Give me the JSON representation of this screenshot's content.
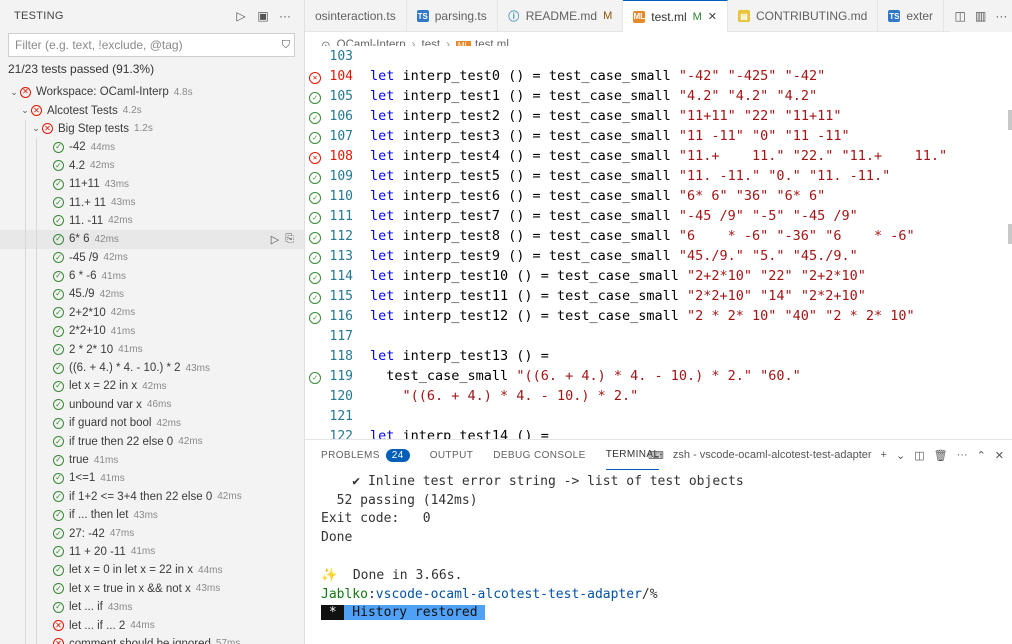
{
  "testing": {
    "title": "TESTING",
    "filter_placeholder": "Filter (e.g. text, !exclude, @tag)",
    "summary": "21/23 tests passed (91.3%)",
    "tree": [
      {
        "label": "Workspace: OCaml-Interp",
        "duration": "4.8s",
        "status": "fail",
        "depth": 0,
        "expanded": true
      },
      {
        "label": "Alcotest Tests",
        "duration": "4.2s",
        "status": "fail",
        "depth": 1,
        "expanded": true
      },
      {
        "label": "Big Step tests",
        "duration": "1.2s",
        "status": "fail",
        "depth": 2,
        "expanded": true
      },
      {
        "label": "-42",
        "duration": "44ms",
        "status": "pass",
        "depth": 3
      },
      {
        "label": "4.2",
        "duration": "42ms",
        "status": "pass",
        "depth": 3
      },
      {
        "label": "11+11",
        "duration": "43ms",
        "status": "pass",
        "depth": 3
      },
      {
        "label": "11.+ 11",
        "duration": "43ms",
        "status": "pass",
        "depth": 3
      },
      {
        "label": "11. -11",
        "duration": "42ms",
        "status": "pass",
        "depth": 3
      },
      {
        "label": "6* 6",
        "duration": "42ms",
        "status": "pass",
        "depth": 3,
        "selected": true
      },
      {
        "label": "-45 /9",
        "duration": "42ms",
        "status": "pass",
        "depth": 3
      },
      {
        "label": "6 * -6",
        "duration": "41ms",
        "status": "pass",
        "depth": 3
      },
      {
        "label": "45./9",
        "duration": "42ms",
        "status": "pass",
        "depth": 3
      },
      {
        "label": "2+2*10",
        "duration": "42ms",
        "status": "pass",
        "depth": 3
      },
      {
        "label": "2*2+10",
        "duration": "41ms",
        "status": "pass",
        "depth": 3
      },
      {
        "label": "2 * 2* 10",
        "duration": "41ms",
        "status": "pass",
        "depth": 3
      },
      {
        "label": "((6. + 4.) * 4. - 10.) * 2",
        "duration": "43ms",
        "status": "pass",
        "depth": 3
      },
      {
        "label": "let x = 22 in x",
        "duration": "42ms",
        "status": "pass",
        "depth": 3
      },
      {
        "label": "unbound var x",
        "duration": "46ms",
        "status": "pass",
        "depth": 3
      },
      {
        "label": "if guard not bool",
        "duration": "42ms",
        "status": "pass",
        "depth": 3
      },
      {
        "label": "if true then 22 else 0",
        "duration": "42ms",
        "status": "pass",
        "depth": 3
      },
      {
        "label": "true",
        "duration": "41ms",
        "status": "pass",
        "depth": 3
      },
      {
        "label": "1<=1",
        "duration": "41ms",
        "status": "pass",
        "depth": 3
      },
      {
        "label": "if 1+2 <= 3+4 then 22 else 0",
        "duration": "42ms",
        "status": "pass",
        "depth": 3
      },
      {
        "label": "if ... then let",
        "duration": "43ms",
        "status": "pass",
        "depth": 3
      },
      {
        "label": "27: -42",
        "duration": "47ms",
        "status": "pass",
        "depth": 3
      },
      {
        "label": "11 + 20 -11",
        "duration": "41ms",
        "status": "pass",
        "depth": 3
      },
      {
        "label": "let x = 0 in let x = 22 in x",
        "duration": "44ms",
        "status": "pass",
        "depth": 3
      },
      {
        "label": "let x = true in x && not x",
        "duration": "43ms",
        "status": "pass",
        "depth": 3
      },
      {
        "label": "let ... if",
        "duration": "43ms",
        "status": "pass",
        "depth": 3
      },
      {
        "label": "let ... if ... 2",
        "duration": "44ms",
        "status": "fail",
        "depth": 3
      },
      {
        "label": "comment should be ignored",
        "duration": "57ms",
        "status": "fail",
        "depth": 3
      }
    ]
  },
  "tabs": [
    {
      "label": "osinteraction.ts",
      "icon": "none",
      "mod": "",
      "active": false
    },
    {
      "label": "parsing.ts",
      "icon": "ts",
      "mod": "",
      "active": false
    },
    {
      "label": "README.md",
      "icon": "md",
      "mod": "M",
      "active": false
    },
    {
      "label": "test.ml",
      "icon": "ml",
      "mod": "M",
      "active": true
    },
    {
      "label": "CONTRIBUTING.md",
      "icon": "mdy",
      "mod": "",
      "active": false
    },
    {
      "label": "exter",
      "icon": "ts",
      "mod": "",
      "active": false
    }
  ],
  "breadcrumb": [
    "OCaml-Interp",
    "test",
    "test.ml"
  ],
  "editor": {
    "lines": [
      {
        "num": "103",
        "status": "",
        "code": ""
      },
      {
        "num": "104",
        "status": "fail",
        "code": "let interp_test0 () = test_case_small \"-42\" \"-425\" \"-42\""
      },
      {
        "num": "105",
        "status": "pass",
        "code": "let interp_test1 () = test_case_small \"4.2\" \"4.2\" \"4.2\""
      },
      {
        "num": "106",
        "status": "pass",
        "code": "let interp_test2 () = test_case_small \"11+11\" \"22\" \"11+11\""
      },
      {
        "num": "107",
        "status": "pass",
        "code": "let interp_test3 () = test_case_small \"11 -11\" \"0\" \"11 -11\""
      },
      {
        "num": "108",
        "status": "fail",
        "code": "let interp_test4 () = test_case_small \"11.+    11.\" \"22.\" \"11.+    11.\""
      },
      {
        "num": "109",
        "status": "pass",
        "code": "let interp_test5 () = test_case_small \"11. -11.\" \"0.\" \"11. -11.\""
      },
      {
        "num": "110",
        "status": "pass",
        "code": "let interp_test6 () = test_case_small \"6* 6\" \"36\" \"6* 6\""
      },
      {
        "num": "111",
        "status": "pass",
        "code": "let interp_test7 () = test_case_small \"-45 /9\" \"-5\" \"-45 /9\""
      },
      {
        "num": "112",
        "status": "pass",
        "code": "let interp_test8 () = test_case_small \"6    * -6\" \"-36\" \"6    * -6\""
      },
      {
        "num": "113",
        "status": "pass",
        "code": "let interp_test9 () = test_case_small \"45./9.\" \"5.\" \"45./9.\""
      },
      {
        "num": "114",
        "status": "pass",
        "code": "let interp_test10 () = test_case_small \"2+2*10\" \"22\" \"2+2*10\""
      },
      {
        "num": "115",
        "status": "pass",
        "code": "let interp_test11 () = test_case_small \"2*2+10\" \"14\" \"2*2+10\""
      },
      {
        "num": "116",
        "status": "pass",
        "code": "let interp_test12 () = test_case_small \"2 * 2* 10\" \"40\" \"2 * 2* 10\""
      },
      {
        "num": "117",
        "status": "",
        "code": ""
      },
      {
        "num": "118",
        "status": "",
        "code": "let interp_test13 () ="
      },
      {
        "num": "119",
        "status": "pass",
        "code": "  test_case_small \"((6. + 4.) * 4. - 10.) * 2.\" \"60.\""
      },
      {
        "num": "120",
        "status": "",
        "code": "    \"((6. + 4.) * 4. - 10.) * 2.\""
      },
      {
        "num": "121",
        "status": "",
        "code": ""
      },
      {
        "num": "122",
        "status": "",
        "code": "let interp_test14 () ="
      }
    ]
  },
  "panel": {
    "tabs": [
      {
        "label": "PROBLEMS",
        "badge": "24",
        "active": false
      },
      {
        "label": "OUTPUT",
        "badge": "",
        "active": false
      },
      {
        "label": "DEBUG CONSOLE",
        "badge": "",
        "active": false
      },
      {
        "label": "TERMINAL",
        "badge": "",
        "active": true
      }
    ],
    "terminal_name": "zsh - vscode-ocaml-alcotest-test-adapter",
    "terminal": {
      "line1": "    ✔ Inline test error string -> list of test objects",
      "line2": "  52 passing (142ms)",
      "line3": "Exit code:   0",
      "line4": "Done",
      "line5": "",
      "line6": "✨  Done in 3.66s.",
      "prompt_user": "Jablko",
      "prompt_path": "vscode-ocaml-alcotest-test-adapter",
      "prompt_suffix": "/%",
      "history_star": " * ",
      "history_text": " History restored ",
      "line9": ""
    }
  }
}
